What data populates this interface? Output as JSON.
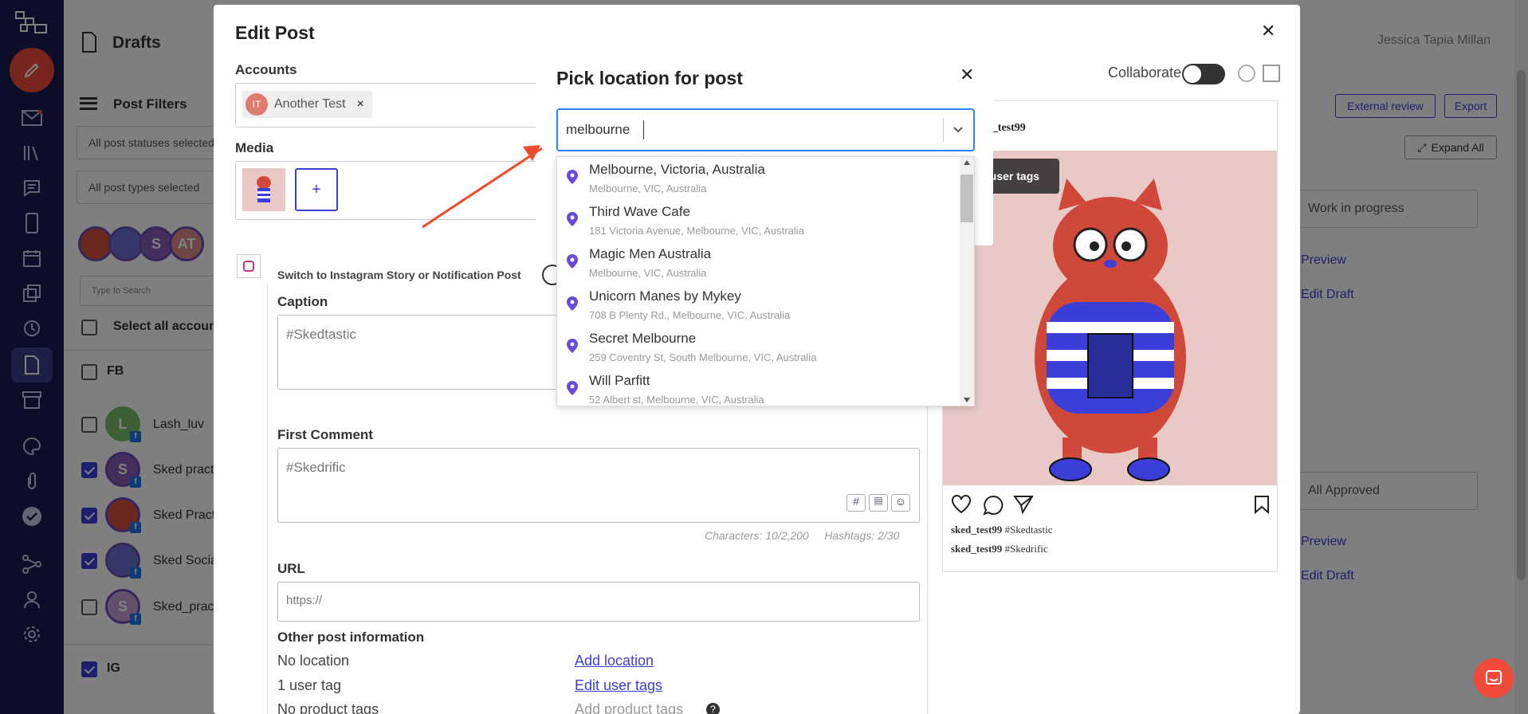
{
  "nav": {
    "items": [
      "compose-icon",
      "inbox-icon",
      "library-icon",
      "chat-icon",
      "mobile-icon",
      "calendar-icon",
      "copy-icon",
      "history-icon",
      "drafts-icon",
      "archive-icon",
      "palette-icon",
      "link-icon",
      "approved-icon",
      "share-icon",
      "user-icon",
      "settings-icon"
    ]
  },
  "background": {
    "page_title": "Drafts",
    "user_name": "Jessica Tapia Millan",
    "post_filters": "Post Filters",
    "statuses_select": "All post statuses selected",
    "types_select": "All post types selected",
    "search_placeholder": "Type to Search",
    "select_all": "Select all accounts",
    "group_fb": "FB",
    "group_ig": "IG",
    "accounts": [
      "Lash_luv",
      "Sked practice",
      "Sked Practice",
      "Sked Social",
      "Sked_prac"
    ],
    "external_review": "External review",
    "export": "Export",
    "expand_all": "Expand All",
    "status1": "Work in progress",
    "status2": "All Approved",
    "preview": "Preview",
    "edit_draft": "Edit Draft"
  },
  "edit_post": {
    "title": "Edit Post",
    "accounts_label": "Accounts",
    "account_chip": "Another Test",
    "media_label": "Media",
    "add_media": "+",
    "collaborate": "Collaborate",
    "switch_story": "Switch to Instagram Story or Notification Post",
    "caption_label": "Caption",
    "caption_value": "#Skedtastic",
    "first_comment_label": "First Comment",
    "first_comment_value": "#Skedrific",
    "counts": "Characters: 10/2,200     Hashtags: 2/30",
    "url_label": "URL",
    "url_placeholder": "https://",
    "other_info_label": "Other post information",
    "location_status": "No location",
    "add_location": "Add location",
    "user_tags_status": "1 user tag",
    "edit_user_tags": "Edit user tags",
    "product_tags_status": "No product tags",
    "add_product_tags": "Add product tags",
    "preview_username": "sked_test99",
    "preview_username_partial": "ked_test99",
    "show_user_tags": "w user tags",
    "preview_caption": "#Skedtastic",
    "preview_comment": "#Skedrific"
  },
  "location_picker": {
    "title": "Pick location for post",
    "query": "melbourne",
    "options": [
      {
        "name": "Melbourne, Victoria, Australia",
        "address": "Melbourne, VIC, Australia"
      },
      {
        "name": "Third Wave Cafe",
        "address": "181 Victoria Avenue, Melbourne, VIC, Australia"
      },
      {
        "name": "Magic Men Australia",
        "address": "Melbourne, VIC, Australia"
      },
      {
        "name": "Unicorn Manes by Mykey",
        "address": "708 B Plenty Rd., Melbourne, VIC, Australia"
      },
      {
        "name": "Secret Melbourne",
        "address": "259 Coventry St, South Melbourne, VIC, Australia"
      },
      {
        "name": "Will Parfitt",
        "address": "52 Albert st, Melbourne, VIC, Australia"
      }
    ]
  },
  "colors": {
    "accent": "#3b3fd8",
    "nav_bg": "#161b52",
    "annotation_arrow": "#ef4a2a",
    "compose": "#ef4a3a"
  }
}
